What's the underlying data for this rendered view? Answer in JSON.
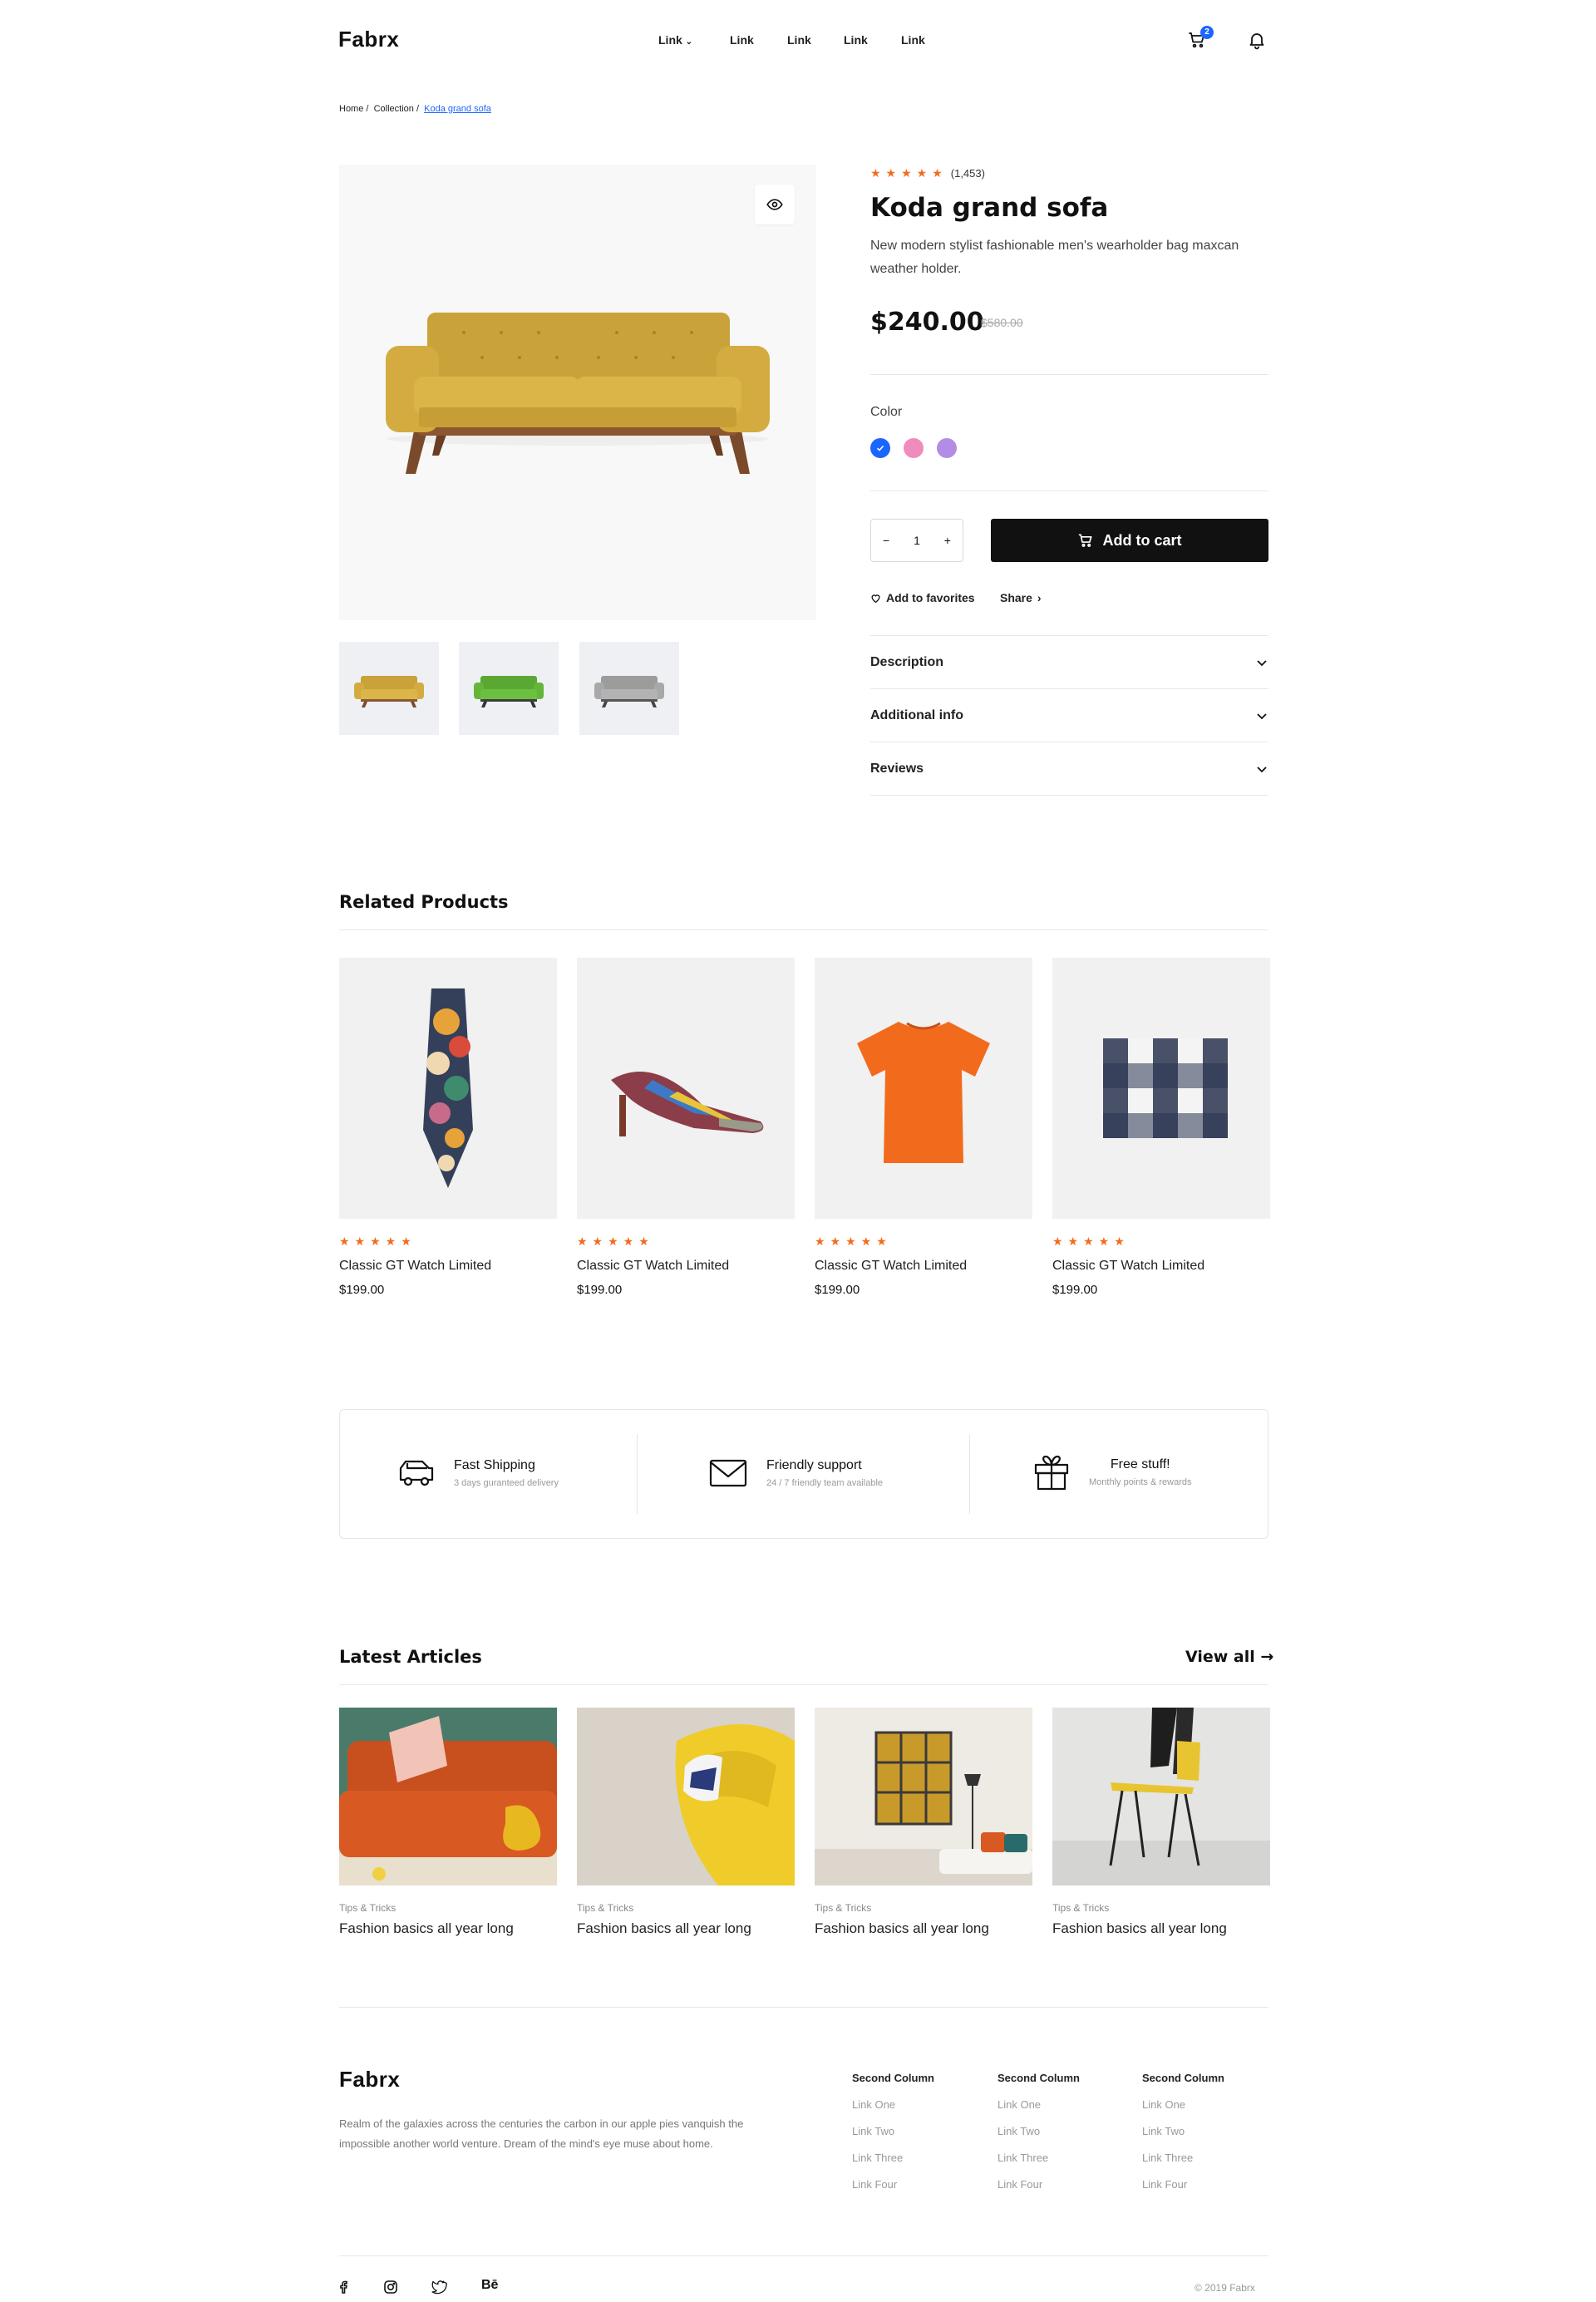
{
  "header": {
    "logo": "Fabrx",
    "nav": [
      "Link",
      "Link",
      "Link",
      "Link",
      "Link"
    ],
    "cart_count": "2"
  },
  "breadcrumb": {
    "home": "Home /",
    "collection": "Collection /",
    "current": "Koda grand sofa"
  },
  "product": {
    "rating_stars": "★★★★★",
    "rating_count": "(1,453)",
    "title": "Koda grand sofa",
    "description": "New modern stylist fashionable men's wearholder bag maxcan weather holder.",
    "price": "$240.00",
    "old_price": "$580.00",
    "color_label": "Color",
    "colors": [
      "#1a66ff",
      "#f08cbc",
      "#b28ce6"
    ],
    "quantity": "1",
    "add_to_cart": "Add to cart",
    "add_to_favorites": "Add to favorites",
    "share": "Share",
    "accordion": [
      "Description",
      "Additional info",
      "Reviews"
    ]
  },
  "related": {
    "title": "Related Products",
    "items": [
      {
        "stars": "★★★★★",
        "name": "Classic GT Watch Limited",
        "price": "$199.00"
      },
      {
        "stars": "★★★★★",
        "name": "Classic GT Watch Limited",
        "price": "$199.00"
      },
      {
        "stars": "★★★★★",
        "name": "Classic GT Watch Limited",
        "price": "$199.00"
      },
      {
        "stars": "★★★★★",
        "name": "Classic GT Watch Limited",
        "price": "$199.00"
      }
    ]
  },
  "features": [
    {
      "icon": "truck-icon",
      "title": "Fast Shipping",
      "sub": "3 days guranteed delivery"
    },
    {
      "icon": "mail-icon",
      "title": "Friendly support",
      "sub": "24 / 7 friendly team available"
    },
    {
      "icon": "gift-icon",
      "title": "Free stuff!",
      "sub": "Monthly points & rewards"
    }
  ],
  "articles": {
    "title": "Latest Articles",
    "view_all": "View all →",
    "items": [
      {
        "tag": "Tips & Tricks",
        "title": "Fashion basics all year long"
      },
      {
        "tag": "Tips & Tricks",
        "title": "Fashion basics all year long"
      },
      {
        "tag": "Tips & Tricks",
        "title": "Fashion basics all year long"
      },
      {
        "tag": "Tips & Tricks",
        "title": "Fashion basics all year long"
      }
    ]
  },
  "footer": {
    "logo": "Fabrx",
    "about": "Realm of the galaxies across the centuries the carbon in our apple pies vanquish the impossible another world venture. Dream of the mind's eye muse about home.",
    "columns": [
      {
        "heading": "Second Column",
        "links": [
          "Link One",
          "Link Two",
          "Link Three",
          "Link Four"
        ]
      },
      {
        "heading": "Second Column",
        "links": [
          "Link One",
          "Link Two",
          "Link Three",
          "Link Four"
        ]
      },
      {
        "heading": "Second Column",
        "links": [
          "Link One",
          "Link Two",
          "Link Three",
          "Link Four"
        ]
      }
    ],
    "social": [
      "facebook-icon",
      "instagram-icon",
      "twitter-icon",
      "behance-icon"
    ],
    "behance_text": "Bē",
    "copyright": "© 2019 Fabrx"
  }
}
